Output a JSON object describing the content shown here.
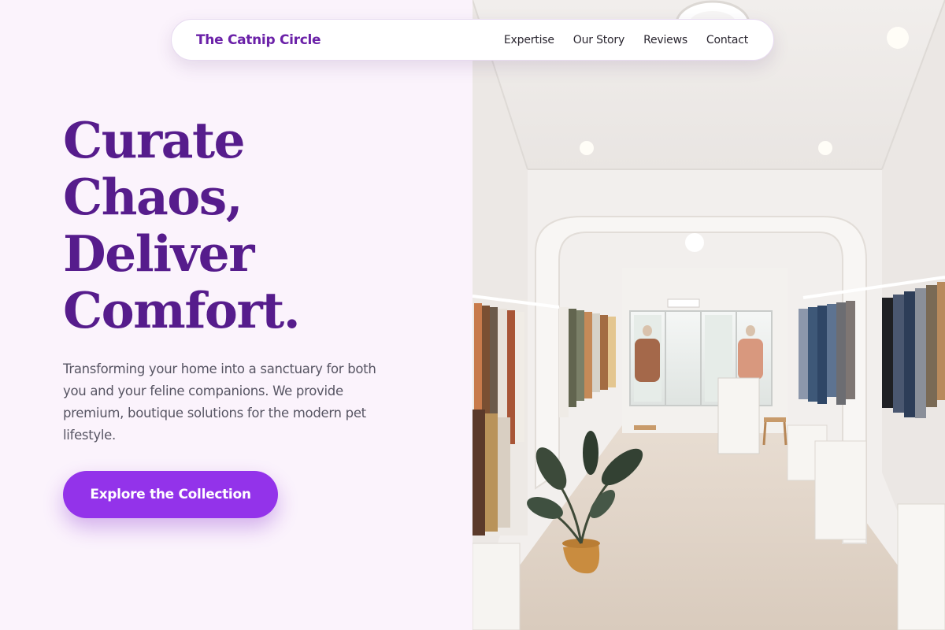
{
  "navbar": {
    "brand": "The Catnip Circle",
    "links": [
      {
        "label": "Expertise"
      },
      {
        "label": "Our Story"
      },
      {
        "label": "Reviews"
      },
      {
        "label": "Contact"
      }
    ]
  },
  "hero": {
    "title_lines": [
      "Curate",
      "Chaos,",
      "Deliver",
      "Comfort."
    ],
    "description": "Transforming your home into a sanctuary for both you and your feline companions. We provide premium, boutique solutions for the modern pet lifestyle.",
    "cta_label": "Explore the Collection"
  },
  "colors": {
    "brand": "#6b21a8",
    "title": "#561c8c",
    "accent": "#9333ea",
    "left_background": "#fbf3fc"
  }
}
